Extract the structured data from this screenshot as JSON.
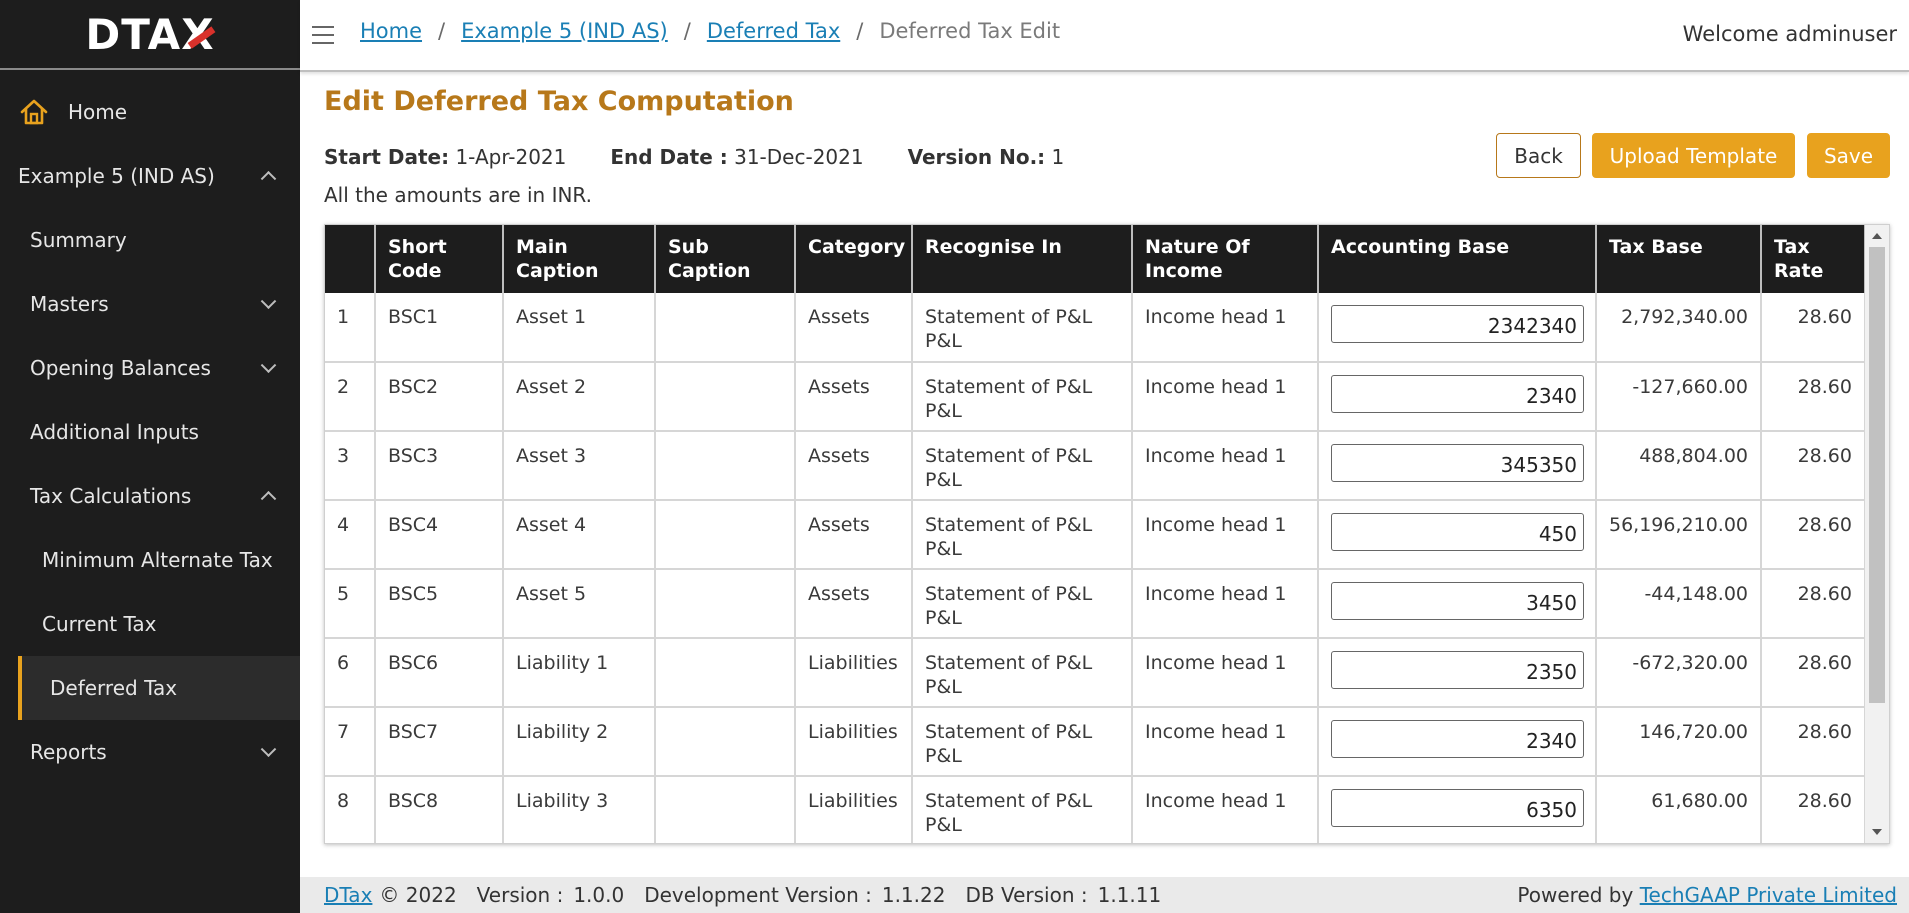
{
  "logo": {
    "text_main": "DTA",
    "text_x": "X"
  },
  "sidebar": {
    "home": "Home",
    "project": "Example 5 (IND AS)",
    "summary": "Summary",
    "masters": "Masters",
    "opening_balances": "Opening Balances",
    "additional_inputs": "Additional Inputs",
    "tax_calculations": "Tax Calculations",
    "minimum_alternate_tax": "Minimum Alternate Tax",
    "current_tax": "Current Tax",
    "deferred_tax": "Deferred Tax",
    "reports": "Reports"
  },
  "breadcrumb": {
    "home": "Home",
    "project": "Example 5 (IND AS)",
    "deferred_tax": "Deferred Tax",
    "current": "Deferred Tax Edit",
    "sep": "/"
  },
  "header": {
    "welcome": "Welcome adminuser"
  },
  "page": {
    "title": "Edit Deferred Tax Computation",
    "start_date_label": "Start Date:",
    "start_date": "1-Apr-2021",
    "end_date_label": "End Date :",
    "end_date": "31-Dec-2021",
    "version_label": "Version No.:",
    "version": "1",
    "note": "All the amounts are in INR."
  },
  "buttons": {
    "back": "Back",
    "upload": "Upload Template",
    "save": "Save"
  },
  "table": {
    "headers": [
      "",
      "Short Code",
      "Main Caption",
      "Sub Caption",
      "Category",
      "Recognise In",
      "Nature Of Income",
      "Accounting Base",
      "Tax Base",
      "Tax Rate"
    ],
    "rows": [
      {
        "n": "1",
        "code": "BSC1",
        "main": "Asset 1",
        "sub": "",
        "cat": "Assets",
        "rec": "Statement of P&L P&L",
        "nature": "Income head 1",
        "acc": "2342340",
        "tax": "2,792,340.00",
        "rate": "28.60"
      },
      {
        "n": "2",
        "code": "BSC2",
        "main": "Asset 2",
        "sub": "",
        "cat": "Assets",
        "rec": "Statement of P&L P&L",
        "nature": "Income head 1",
        "acc": "2340",
        "tax": "-127,660.00",
        "rate": "28.60"
      },
      {
        "n": "3",
        "code": "BSC3",
        "main": "Asset 3",
        "sub": "",
        "cat": "Assets",
        "rec": "Statement of P&L P&L",
        "nature": "Income head 1",
        "acc": "345350",
        "tax": "488,804.00",
        "rate": "28.60"
      },
      {
        "n": "4",
        "code": "BSC4",
        "main": "Asset 4",
        "sub": "",
        "cat": "Assets",
        "rec": "Statement of P&L P&L",
        "nature": "Income head 1",
        "acc": "450",
        "tax": "56,196,210.00",
        "rate": "28.60"
      },
      {
        "n": "5",
        "code": "BSC5",
        "main": "Asset 5",
        "sub": "",
        "cat": "Assets",
        "rec": "Statement of P&L P&L",
        "nature": "Income head 1",
        "acc": "3450",
        "tax": "-44,148.00",
        "rate": "28.60"
      },
      {
        "n": "6",
        "code": "BSC6",
        "main": "Liability 1",
        "sub": "",
        "cat": "Liabilities",
        "rec": "Statement of P&L P&L",
        "nature": "Income head 1",
        "acc": "2350",
        "tax": "-672,320.00",
        "rate": "28.60"
      },
      {
        "n": "7",
        "code": "BSC7",
        "main": "Liability 2",
        "sub": "",
        "cat": "Liabilities",
        "rec": "Statement of P&L P&L",
        "nature": "Income head 1",
        "acc": "2340",
        "tax": "146,720.00",
        "rate": "28.60"
      },
      {
        "n": "8",
        "code": "BSC8",
        "main": "Liability 3",
        "sub": "",
        "cat": "Liabilities",
        "rec": "Statement of P&L P&L",
        "nature": "Income head 1",
        "acc": "6350",
        "tax": "61,680.00",
        "rate": "28.60"
      }
    ]
  },
  "footer": {
    "brand": "DTax",
    "copyright": "© 2022",
    "version_label": "Version :",
    "version": "1.0.0",
    "dev_version_label": "Development Version :",
    "dev_version": "1.1.22",
    "db_version_label": "DB Version :",
    "db_version": "1.1.11",
    "powered_by": "Powered by",
    "company": "TechGAAP Private Limited"
  },
  "colors": {
    "accent": "#e8a21e",
    "title": "#b7781a",
    "sidebar": "#1d1d1d",
    "link": "#1a7fb5",
    "logo_slash": "#d9312b"
  },
  "icons": [
    "home-icon",
    "chevron-up-icon",
    "chevron-down-icon",
    "hamburger-icon"
  ]
}
